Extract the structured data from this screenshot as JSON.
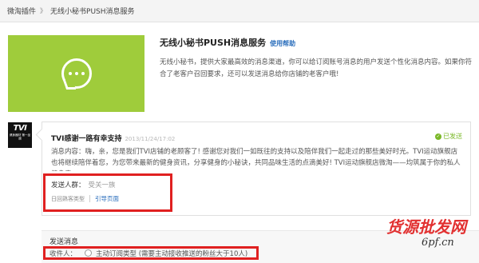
{
  "breadcrumb": {
    "parent": "微淘插件",
    "separator": "》",
    "current": "无线小秘书PUSH消息服务"
  },
  "service": {
    "title": "无线小秘书PUSH消息服务",
    "help_link": "使用帮助",
    "description": "无线小秘书，提供大家最高效的消息渠道，你可以给订阅账号消息的用户发送个性化消息内容。如果你符合了老客户召回要求，还可以发送消息给你店铺的老客户哦!",
    "icon_color": "#9fcc3b",
    "icon": "chat-bubble-icon"
  },
  "message": {
    "logo_text": "TVI",
    "logo_sub": "健身器材 第一品牌",
    "title": "TVI感谢一路有幸支持",
    "time": "2013/11/24/17:02",
    "status": "已发送",
    "body": "消息内容：嗨，亲，您是我们TVI店铺的老顾客了! 感谢您对我们一如既往的支持以及陪伴我们一起走过的那些美好时光。TVI运动旗舰店也将继续陪伴着您，为您带来最新的健身资讯，分享健身的小秘诀，共同品味生活的点滴美好! TVI运动旗舰店微淘——均筑属于你的私人健身房。",
    "target_label": "发送人群：",
    "target_value": "受关一族",
    "type_label": "日回熟客类型",
    "guide_link": "引导页面"
  },
  "send": {
    "section_label": "发送消息",
    "recipient_label": "收件人：",
    "option_label": "主动订阅类型 (需要主动接收推送的粉丝大于10人)"
  },
  "watermark": {
    "main": "货源批发网",
    "url": "6pf.cn"
  },
  "colors": {
    "accent": "#9fcc3b",
    "highlight": "#e02020",
    "link": "#2a6ebc",
    "success": "#7ab827"
  }
}
